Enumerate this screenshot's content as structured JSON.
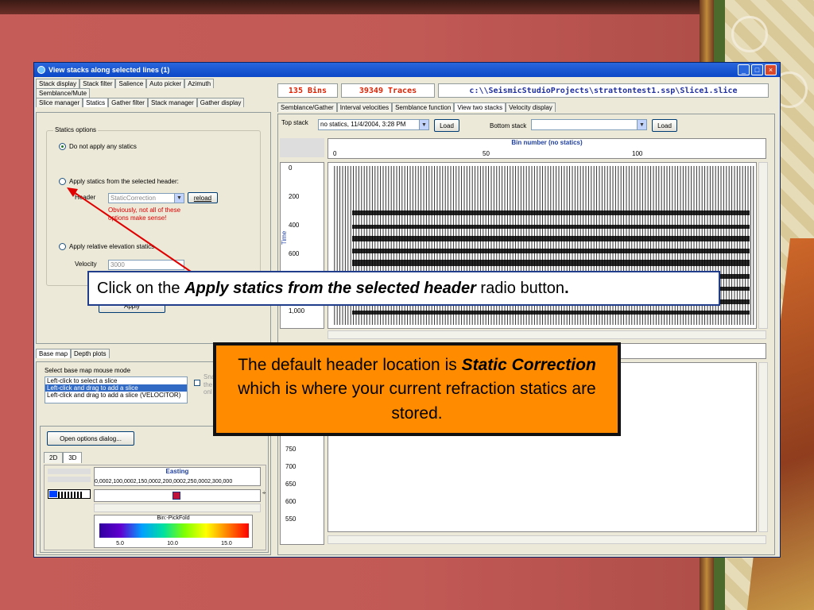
{
  "window": {
    "title": "View stacks along selected lines    (1)"
  },
  "left_tabs_row1": [
    "Stack display",
    "Stack filter",
    "Salience",
    "Auto picker",
    "Azimuth",
    "Semblance/Mute"
  ],
  "left_tabs_row2": [
    "Slice manager",
    "Statics",
    "Gather filter",
    "Stack manager",
    "Gather display"
  ],
  "statics": {
    "group_label": "Statics options",
    "opt1": "Do not apply any statics",
    "opt2": "Apply statics from the selected header:",
    "header_label": "Header",
    "header_value": "StaticCorrection",
    "reload": "reload",
    "warning": "Obviously, not all of these options make sense!",
    "opt3": "Apply relative elevation statics",
    "velocity_label": "Velocity",
    "velocity_value": "3000",
    "apply": "Apply"
  },
  "basemap": {
    "tabs": [
      "Base map",
      "Depth plots"
    ],
    "mode_label": "Select base map mouse mode",
    "modes": [
      "Left-click to select a slice",
      "Left-click and drag to add a slice",
      "Left-click and drag to add a slice (VELOCITOR)"
    ],
    "snap_label": "Sna",
    "snap_sub1": "the",
    "snap_sub2": "onl",
    "open_options": "Open options dialog...",
    "view_tabs": [
      "2D",
      "3D"
    ],
    "easting_title": "Easting",
    "easting_ticks": "0,0002,100,0002,150,0002,200,0002,250,0002,300,000",
    "colorbar_title": "Bin:-PickFold",
    "colorbar_ticks": [
      "5.0",
      "10.0",
      "15.0"
    ]
  },
  "info": {
    "bins": "135 Bins",
    "traces": "39349 Traces",
    "path": "c:\\\\SeismicStudioProjects\\strattontest1.ssp\\Slice1.slice"
  },
  "right_tabs": [
    "Semblance/Gather",
    "Interval velocities",
    "Semblance function",
    "View two stacks",
    "Velocity display"
  ],
  "stacks": {
    "top_label": "Top stack",
    "top_value": "no statics, 11/4/2004, 3:28 PM",
    "load": "Load",
    "bottom_label": "Bottom stack",
    "bottom_value": "",
    "load2": "Load"
  },
  "plot": {
    "title": "Bin number  (no statics)",
    "x_ticks": [
      "0",
      "50",
      "100"
    ],
    "y_label": "Time",
    "y_ticks": [
      "0",
      "200",
      "400",
      "600",
      "1,000"
    ],
    "y_ticks_lower": [
      "750",
      "700",
      "650",
      "600",
      "550"
    ]
  },
  "callouts": {
    "c1_pre": "Click on the ",
    "c1_bold": "Apply statics from the selected header",
    "c1_post": " radio button",
    "c1_dot": ".",
    "c2_pre": "The default header location is ",
    "c2_bold": "Static Correction",
    "c2_post": " which is where your current refraction statics are stored."
  }
}
